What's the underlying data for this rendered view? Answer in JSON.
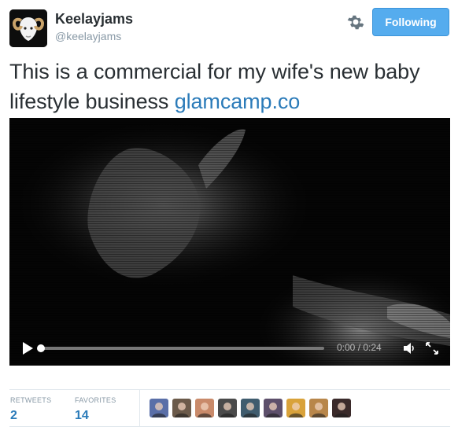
{
  "user": {
    "name": "Keelayjams",
    "handle": "@keelayjams",
    "avatar_icon": "ram-avatar"
  },
  "actions": {
    "settings_icon": "gear-icon",
    "follow_label": "Following"
  },
  "tweet": {
    "text": "This is a commercial for my wife's new baby lifestyle business ",
    "link_text": "glamcamp.co"
  },
  "video": {
    "time": "0:00 / 0:24",
    "progress": 0.0,
    "icons": [
      "play-icon",
      "volume-icon",
      "fullscreen-icon"
    ]
  },
  "stats": {
    "retweets_label": "RETWEETS",
    "retweets_count": "2",
    "favorites_label": "FAVORITES",
    "favorites_count": "14"
  },
  "favoriters": [
    {
      "color": "#5a6fa8"
    },
    {
      "color": "#6b5a4a"
    },
    {
      "color": "#c98a6a"
    },
    {
      "color": "#4a4a4a"
    },
    {
      "color": "#3f5c6e"
    },
    {
      "color": "#5d4f6b"
    },
    {
      "color": "#d9a23a"
    },
    {
      "color": "#b8864a"
    },
    {
      "color": "#3a2a2a"
    }
  ],
  "colors": {
    "accent": "#55acee",
    "link": "#2b7bb9",
    "muted": "#8899a6"
  }
}
